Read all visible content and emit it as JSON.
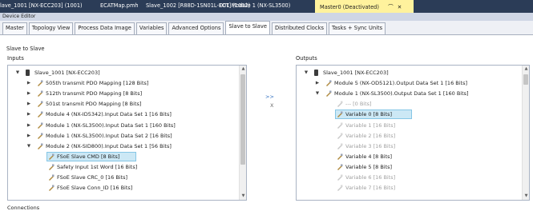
{
  "doc_tabs": [
    {
      "label": "lave_1001 [NX-ECC203] (1001)"
    },
    {
      "label": "ECATMap.pmh"
    },
    {
      "label": "Slave_1002 [R88D-1SN01L-ECT] (1002)"
    },
    {
      "label": "001 Module 1 (NX-SL3500)"
    },
    {
      "label": "Master0 (Deactivated)",
      "pin": "⌒",
      "close": "✕"
    }
  ],
  "editor_title": "Device Editor",
  "sub_tabs": [
    "Master",
    "Topology View",
    "Process Data Image",
    "Variables",
    "Advanced Options",
    "Slave to Slave",
    "Distributed Clocks",
    "Tasks + Sync Units"
  ],
  "active_sub_tab": "Slave to Slave",
  "section_title": "Slave to Slave",
  "inputs_label": "Inputs",
  "outputs_label": "Outputs",
  "map_button": ">>",
  "unmap_button": "X",
  "connections_label": "Connections",
  "inputs_tree": [
    {
      "label": "Slave_1001 [NX-ECC203]",
      "level": 0,
      "expander": "▼",
      "icon": "device-icon"
    },
    {
      "label": "505th transmit PDO Mapping [128 Bits]",
      "level": 1,
      "expander": "▶",
      "icon": "pdo-icon"
    },
    {
      "label": "512th transmit PDO Mapping [8 Bits]",
      "level": 1,
      "expander": "▶",
      "icon": "pdo-icon"
    },
    {
      "label": "501st transmit PDO Mapping [8 Bits]",
      "level": 1,
      "expander": "▶",
      "icon": "pdo-icon"
    },
    {
      "label": "Module 4 (NX-ID5342).Input Data Set 1 [16 Bits]",
      "level": 1,
      "expander": "▶",
      "icon": "pdo-icon"
    },
    {
      "label": "Module 1 (NX-SL3500).Input Data Set 1 [160 Bits]",
      "level": 1,
      "expander": "▶",
      "icon": "pdo-icon"
    },
    {
      "label": "Module 1 (NX-SL3500).Input Data Set 2 [16 Bits]",
      "level": 1,
      "expander": "▶",
      "icon": "pdo-icon"
    },
    {
      "label": "Module 2 (NX-SID800).Input Data Set 1 [56 Bits]",
      "level": 1,
      "expander": "▼",
      "icon": "pdo-icon"
    },
    {
      "label": "FSoE Slave CMD [8 Bits]",
      "level": 2,
      "expander": "",
      "icon": "pdo-icon",
      "selected": true
    },
    {
      "label": "Safety Input 1st Word [16 Bits]",
      "level": 2,
      "expander": "",
      "icon": "pdo-icon"
    },
    {
      "label": "FSoE Slave CRC_0 [16 Bits]",
      "level": 2,
      "expander": "",
      "icon": "pdo-icon"
    },
    {
      "label": "FSoE Slave Conn_ID [16 Bits]",
      "level": 2,
      "expander": "",
      "icon": "pdo-icon"
    }
  ],
  "outputs_tree": [
    {
      "label": "Slave_1001 [NX-ECC203]",
      "level": 0,
      "expander": "▼",
      "icon": "device-icon"
    },
    {
      "label": "Module 5 (NX-OD5121).Output Data Set 1 [16 Bits]",
      "level": 1,
      "expander": "▶",
      "icon": "pdo-icon"
    },
    {
      "label": "Module 1 (NX-SL3500).Output Data Set 1 [160 Bits]",
      "level": 1,
      "expander": "▼",
      "icon": "pdo-icon"
    },
    {
      "label": "--- [0 Bits]",
      "level": 2,
      "expander": "",
      "icon": "pdo-icon",
      "disabled": true
    },
    {
      "label": "Variable 0 [8 Bits]",
      "level": 2,
      "expander": "",
      "icon": "pdo-icon",
      "selected": true
    },
    {
      "label": "Variable 1 [16 Bits]",
      "level": 2,
      "expander": "",
      "icon": "pdo-icon",
      "disabled": true
    },
    {
      "label": "Variable 2 [16 Bits]",
      "level": 2,
      "expander": "",
      "icon": "pdo-icon",
      "disabled": true
    },
    {
      "label": "Variable 3 [16 Bits]",
      "level": 2,
      "expander": "",
      "icon": "pdo-icon",
      "disabled": true
    },
    {
      "label": "Variable 4 [8 Bits]",
      "level": 2,
      "expander": "",
      "icon": "pdo-icon"
    },
    {
      "label": "Variable 5 [8 Bits]",
      "level": 2,
      "expander": "",
      "icon": "pdo-icon"
    },
    {
      "label": "Variable 6 [16 Bits]",
      "level": 2,
      "expander": "",
      "icon": "pdo-icon",
      "disabled": true
    },
    {
      "label": "Variable 7 [16 Bits]",
      "level": 2,
      "expander": "",
      "icon": "pdo-icon",
      "disabled": true
    }
  ],
  "colors": {
    "tab_bar": "#2b3c57",
    "active_tab": "#fff29d",
    "selection": "#cce8f5",
    "map_arrow": "#2f6ebf"
  },
  "scrollbar_icons": {
    "up": "▲",
    "down": "▼"
  }
}
